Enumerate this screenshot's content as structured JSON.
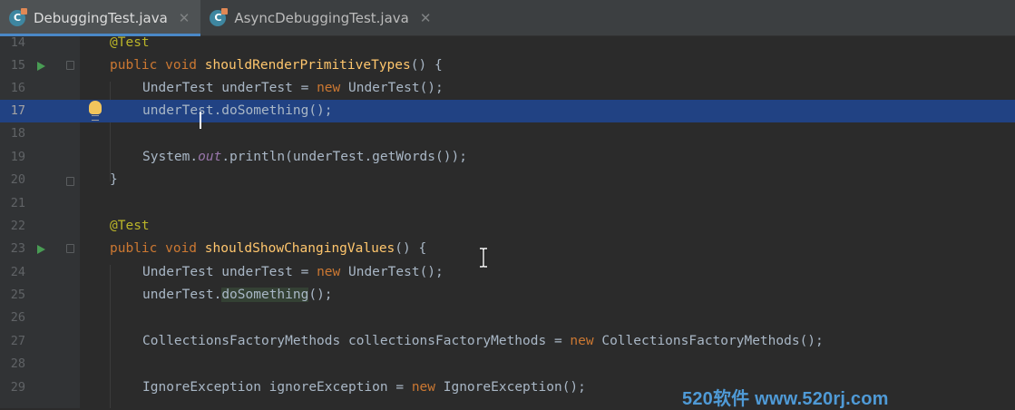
{
  "tabs": [
    {
      "label": "DebuggingTest.java",
      "icon": "java-class-icon",
      "icon_letter": "C",
      "active": true
    },
    {
      "label": "AsyncDebuggingTest.java",
      "icon": "java-class-icon",
      "icon_letter": "C",
      "active": false
    }
  ],
  "tab_close_glyph": "✕",
  "editor": {
    "current_line": 17,
    "lines": [
      {
        "num": "14"
      },
      {
        "num": "15"
      },
      {
        "num": "16"
      },
      {
        "num": "17"
      },
      {
        "num": "18"
      },
      {
        "num": "19"
      },
      {
        "num": "20"
      },
      {
        "num": "21"
      },
      {
        "num": "22"
      },
      {
        "num": "23"
      },
      {
        "num": "24"
      },
      {
        "num": "25"
      },
      {
        "num": "26"
      },
      {
        "num": "27"
      },
      {
        "num": "28"
      },
      {
        "num": "29"
      }
    ],
    "code": {
      "l14": "@Test",
      "l15_kw": "public void ",
      "l15_fn": "shouldRenderPrimitiveTypes",
      "l15_rest": "() {",
      "l16_a": "UnderTest underTest = ",
      "l16_kw": "new",
      "l16_b": " UnderTest();",
      "l17": "underTest.doSomething();",
      "l19_a": "System.",
      "l19_it": "out",
      "l19_b": ".println(underTest.getWords());",
      "l20": "}",
      "l22": "@Test",
      "l23_kw": "public void ",
      "l23_fn": "shouldShowChangingValues",
      "l23_rest": "() {",
      "l24_a": "UnderTest underTest = ",
      "l24_kw": "new",
      "l24_b": " UnderTest();",
      "l25_a": "underTest.",
      "l25_match": "doSomething",
      "l25_b": "();",
      "l27_a": "CollectionsFactoryMethods collectionsFactoryMethods = ",
      "l27_kw": "new",
      "l27_b": " CollectionsFactoryMethods();",
      "l29_a": "IgnoreException ignoreException = ",
      "l29_kw": "new",
      "l29_b": " IgnoreException();"
    }
  },
  "gutter_icons": {
    "run": "run-test-icon",
    "fold": "fold-icon",
    "intention": "lightbulb-icon"
  },
  "watermark": "520软件 www.520rj.com",
  "colors": {
    "background": "#2b2b2b",
    "keyword": "#cc7832",
    "annotation": "#bbb529",
    "method": "#ffc66d",
    "static_field": "#9876aa",
    "selection": "#214283",
    "run": "#499c54",
    "tab_underline": "#4a88c7"
  }
}
